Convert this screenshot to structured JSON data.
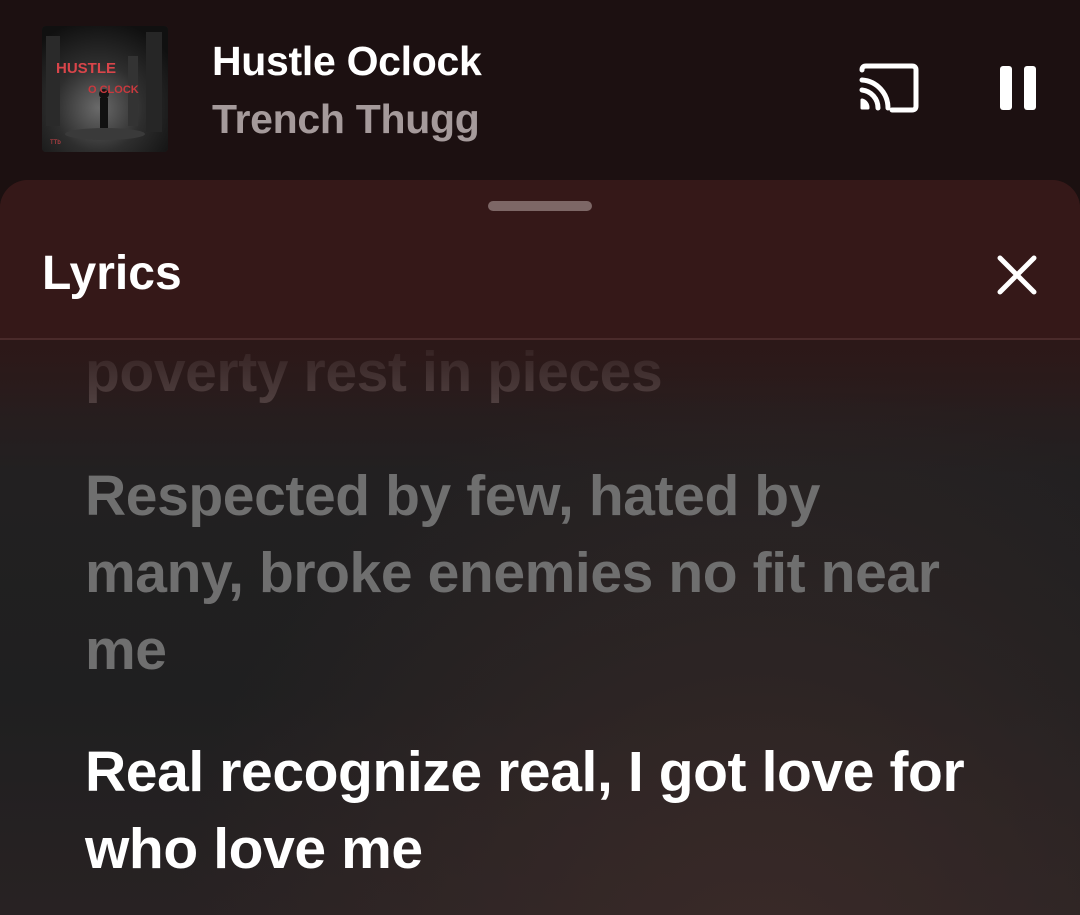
{
  "now_playing": {
    "title": "Hustle Oclock",
    "artist": "Trench Thugg",
    "album_art": {
      "text_line1": "HUSTLE",
      "text_line2": "O CLOCK",
      "corner_mark": "TTb"
    }
  },
  "controls": {
    "cast_icon": "cast-icon",
    "pause_icon": "pause-icon"
  },
  "lyrics_sheet": {
    "title": "Lyrics",
    "close_icon": "close-icon",
    "lines": [
      {
        "text": "poverty rest in pieces",
        "state": "faded"
      },
      {
        "text": "Respected by few, hated by many, broke enemies no fit near me",
        "state": "past"
      },
      {
        "text": "Real recognize real, I got love for who love me",
        "state": "current"
      }
    ]
  },
  "colors": {
    "background": "#1c1011",
    "sheet_header": "#351818",
    "title_text": "#ffffff",
    "artist_text": "#a59a9b",
    "past_lyric": "#6f6f6f",
    "current_lyric": "#ffffff"
  }
}
